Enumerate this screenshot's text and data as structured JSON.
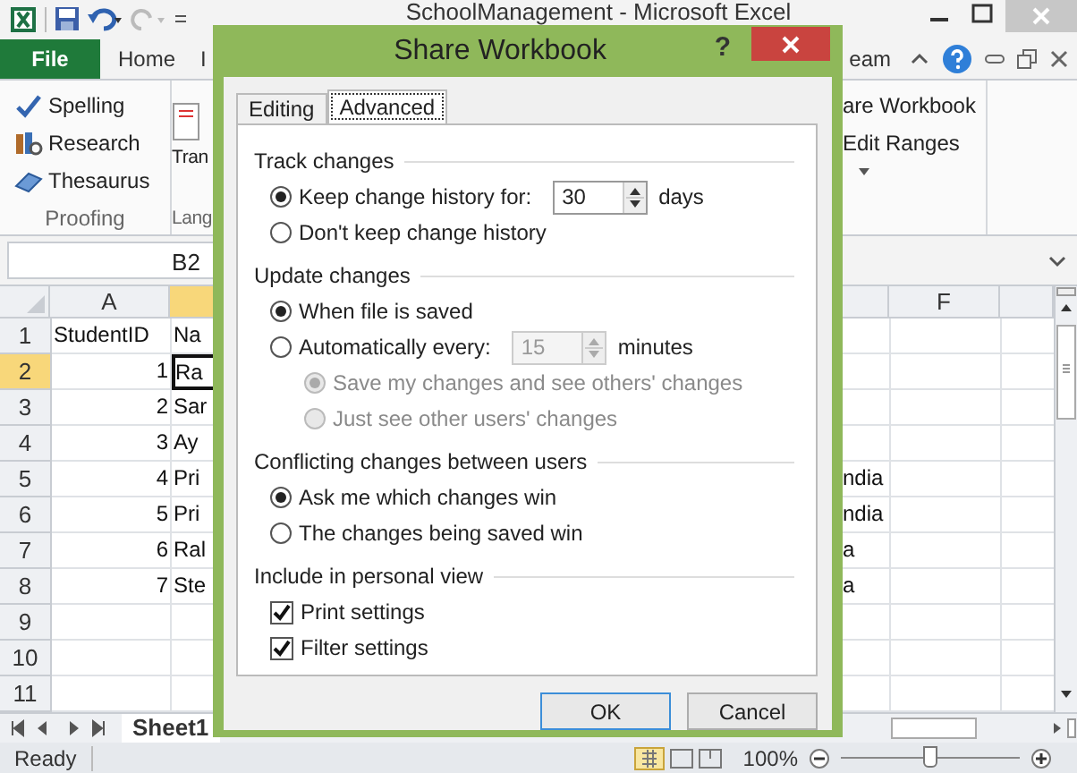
{
  "window": {
    "title": "SchoolManagement - Microsoft Excel"
  },
  "ribbon_tabs": [
    {
      "label": "File",
      "kind": "file"
    },
    {
      "label": "Home",
      "kind": "tab"
    },
    {
      "label": "I",
      "kind": "tab"
    }
  ],
  "ribbon_tab_right": "eam",
  "proofing": {
    "buttons": [
      "Spelling",
      "Research",
      "Thesaurus"
    ],
    "label": "Proofing"
  },
  "language": {
    "button": "Tran",
    "label": "Lang"
  },
  "changes": {
    "buttons": [
      "are Workbook",
      "Edit Ranges"
    ]
  },
  "name_box": "B2",
  "sheet": {
    "columns": [
      {
        "label": "A",
        "selected": false
      },
      {
        "selected": true
      },
      {
        "selected": false
      },
      {
        "label": "F",
        "selected": false
      },
      {
        "selected": false
      }
    ],
    "rows": [
      {
        "num": "1",
        "selected": false,
        "cells": [
          {
            "kind": "text",
            "text": "StudentID"
          },
          {
            "kind": "text",
            "text": "Na"
          }
        ]
      },
      {
        "num": "2",
        "selected": true,
        "cells": [
          {
            "kind": "number",
            "text": "1"
          },
          {
            "kind": "text",
            "text": "Ra"
          }
        ]
      },
      {
        "num": "3",
        "selected": false,
        "cells": [
          {
            "kind": "number",
            "text": "2"
          },
          {
            "kind": "text",
            "text": "Sar"
          }
        ]
      },
      {
        "num": "4",
        "selected": false,
        "cells": [
          {
            "kind": "number",
            "text": "3"
          },
          {
            "kind": "text",
            "text": "Ay"
          }
        ]
      },
      {
        "num": "5",
        "selected": false,
        "cells": [
          {
            "kind": "number",
            "text": "4"
          },
          {
            "kind": "text",
            "text": "Pri"
          },
          {
            "kind": "text",
            "text": "ndia"
          }
        ]
      },
      {
        "num": "6",
        "selected": false,
        "cells": [
          {
            "kind": "number",
            "text": "5"
          },
          {
            "kind": "text",
            "text": "Pri"
          },
          {
            "kind": "text",
            "text": "ndia"
          }
        ]
      },
      {
        "num": "7",
        "selected": false,
        "cells": [
          {
            "kind": "number",
            "text": "6"
          },
          {
            "kind": "text",
            "text": "Ral"
          },
          {
            "kind": "text",
            "text": "a"
          }
        ]
      },
      {
        "num": "8",
        "selected": false,
        "cells": [
          {
            "kind": "number",
            "text": "7"
          },
          {
            "kind": "text",
            "text": "Ste"
          },
          {
            "kind": "text",
            "text": "a"
          }
        ]
      },
      {
        "num": "9",
        "selected": false
      },
      {
        "num": "10",
        "selected": false
      },
      {
        "num": "11",
        "selected": false
      }
    ]
  },
  "sheet_tabs": [
    {
      "label": "Sheet1",
      "selected": true
    }
  ],
  "status_bar": {
    "text": "Ready",
    "zoom": "100%",
    "zoom_level": {
      "level": 0.5
    }
  },
  "dialog": {
    "title": "Share Workbook",
    "help": "?",
    "tabs": [
      {
        "label": "Editing",
        "selected": false
      },
      {
        "label": "Advanced",
        "selected": true
      }
    ],
    "sections": [
      {
        "title": "Track changes",
        "items": [
          {
            "kind": "radio",
            "label": "Keep change history for:",
            "selected": true,
            "disabled": false,
            "spinner": {
              "value": "30",
              "disabled": false
            },
            "unit": "days"
          },
          {
            "kind": "radio",
            "label": "Don't keep change history",
            "selected": false,
            "disabled": false
          }
        ]
      },
      {
        "title": "Update changes",
        "items": [
          {
            "kind": "radio",
            "label": "When file is saved",
            "selected": true,
            "disabled": false
          },
          {
            "kind": "radio",
            "label": "Automatically every:",
            "selected": false,
            "disabled": false,
            "spinner": {
              "value": "15",
              "disabled": true
            },
            "unit": "minutes",
            "children": [
              {
                "kind": "radio",
                "label": "Save my changes and see others' changes",
                "selected": true,
                "disabled": true
              },
              {
                "kind": "radio",
                "label": "Just see other users' changes",
                "selected": false,
                "disabled": true
              }
            ]
          }
        ]
      },
      {
        "title": "Conflicting changes between users",
        "items": [
          {
            "kind": "radio",
            "label": "Ask me which changes win",
            "selected": true,
            "disabled": false
          },
          {
            "kind": "radio",
            "label": "The changes being saved win",
            "selected": false,
            "disabled": false
          }
        ]
      },
      {
        "title": "Include in personal view",
        "items": [
          {
            "kind": "checkbox",
            "label": "Print settings",
            "checked": true
          },
          {
            "kind": "checkbox",
            "label": "Filter settings",
            "checked": true
          }
        ]
      }
    ],
    "buttons": [
      {
        "label": "OK",
        "default": true
      },
      {
        "label": "Cancel",
        "default": false
      }
    ]
  }
}
